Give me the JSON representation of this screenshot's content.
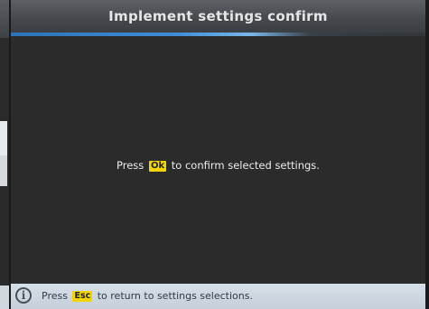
{
  "window": {
    "title": "Implement settings confirm"
  },
  "confirm_message": {
    "prefix": "Press",
    "key": "Ok",
    "suffix": "to confirm selected settings."
  },
  "info_bar": {
    "icon": "info-icon",
    "icon_glyph": "i",
    "prefix": "Press",
    "key": "Esc",
    "suffix": "to return to settings selections."
  },
  "colors": {
    "key_highlight": "#f1d400",
    "title_accent": "#3f8fd6",
    "background": "#2b2b2b",
    "info_bar": "#d7e0e8"
  }
}
